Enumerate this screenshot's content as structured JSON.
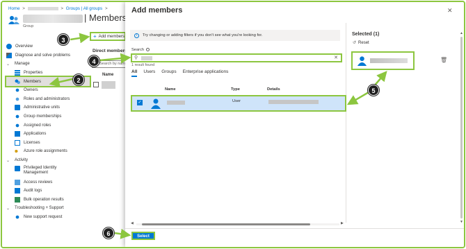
{
  "breadcrumb": {
    "home": "Home",
    "groups": "Groups | All groups",
    "sep": ">"
  },
  "header": {
    "title": "| Members",
    "subtitle": "Group"
  },
  "nav": {
    "overview": "Overview",
    "diagnose": "Diagnose and solve problems",
    "manage": "Manage",
    "properties": "Properties",
    "members": "Members",
    "owners": "Owners",
    "roles": "Roles and administrators",
    "admin_units": "Administrative units",
    "group_memberships": "Group memberships",
    "assigned_roles": "Assigned roles",
    "applications": "Applications",
    "licenses": "Licenses",
    "azure_roles": "Azure role assignments",
    "activity": "Activity",
    "pim": "Privileged Identity Management",
    "access_reviews": "Access reviews",
    "audit_logs": "Audit logs",
    "bulk_ops": "Bulk operation results",
    "troubleshooting": "Troubleshooting + Support",
    "new_support": "New support request"
  },
  "members_pane": {
    "add_members": "Add members",
    "direct_members": "Direct members",
    "search_placeholder": "Search by name",
    "name_col": "Name"
  },
  "blade": {
    "title": "Add members",
    "info": "Try changing or adding filters if you don't see what you're looking for.",
    "search_label": "Search",
    "result_count": "1 result found",
    "tabs": [
      "All",
      "Users",
      "Groups",
      "Enterprise applications"
    ],
    "columns": {
      "name": "Name",
      "type": "Type",
      "details": "Details"
    },
    "result": {
      "type": "User"
    },
    "select": "Select"
  },
  "selected": {
    "title": "Selected (1)",
    "reset": "Reset"
  },
  "callouts": [
    "2",
    "3",
    "4",
    "5",
    "6"
  ],
  "colors": {
    "accent": "#0078d4",
    "highlight": "#8cc63f",
    "selected_row": "#cfe4fa"
  }
}
